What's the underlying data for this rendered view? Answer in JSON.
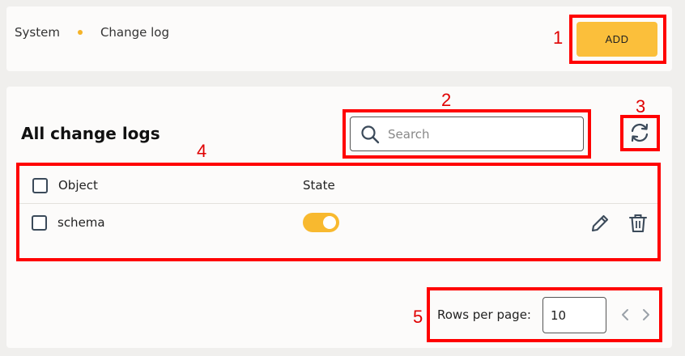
{
  "breadcrumb": {
    "items": [
      "System",
      "Change log"
    ]
  },
  "toolbar": {
    "add_label": "ADD"
  },
  "section": {
    "title": "All change logs"
  },
  "search": {
    "placeholder": "Search",
    "value": ""
  },
  "table": {
    "headers": {
      "object": "Object",
      "state": "State"
    },
    "rows": [
      {
        "object": "schema",
        "state_on": true
      }
    ]
  },
  "pagination": {
    "rows_per_page_label": "Rows per page:",
    "rows_per_page_value": "10"
  },
  "annotations": {
    "m1": "1",
    "m2": "2",
    "m3": "3",
    "m4": "4",
    "m5": "5"
  },
  "icons": [
    "search-icon",
    "refresh-icon",
    "edit-icon",
    "delete-icon",
    "chevron-left-icon",
    "chevron-right-icon"
  ],
  "colors": {
    "accent": "#fbbf3b",
    "annotation": "#ff0000",
    "toggle_on": "#f8b92f"
  }
}
